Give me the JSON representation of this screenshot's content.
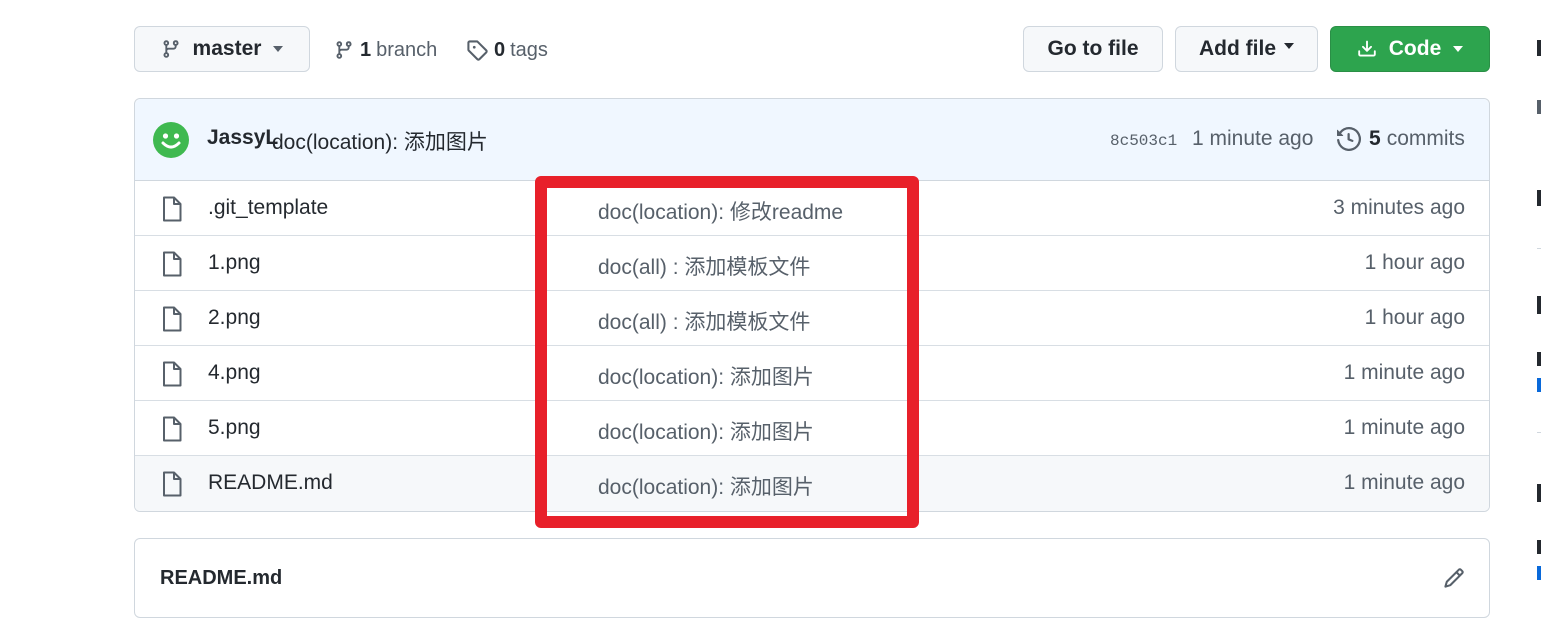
{
  "branch_button": {
    "label": "master"
  },
  "branch_link": {
    "count": "1",
    "label": "branch"
  },
  "tags_link": {
    "count": "0",
    "label": "tags"
  },
  "toolbar": {
    "go_to_file": "Go to file",
    "add_file": "Add file",
    "code": "Code"
  },
  "latest_commit": {
    "author": "JassyL",
    "message": "doc(location): 添加图片",
    "sha": "8c503c1",
    "time": "1 minute ago",
    "commits_count": "5",
    "commits_label": "commits"
  },
  "files": [
    {
      "name": ".git_template",
      "message": "doc(location): 修改readme",
      "time": "3 minutes ago"
    },
    {
      "name": "1.png",
      "message": "doc(all) : 添加模板文件",
      "time": "1 hour ago"
    },
    {
      "name": "2.png",
      "message": "doc(all) : 添加模板文件",
      "time": "1 hour ago"
    },
    {
      "name": "4.png",
      "message": "doc(location): 添加图片",
      "time": "1 minute ago"
    },
    {
      "name": "5.png",
      "message": "doc(location): 添加图片",
      "time": "1 minute ago"
    },
    {
      "name": "README.md",
      "message": "doc(location): 添加图片",
      "time": "1 minute ago"
    }
  ],
  "readme": {
    "title": "README.md"
  },
  "colors": {
    "code_button": "#2da44e",
    "highlight_box": "#e8202a",
    "commit_header": "#f0f7ff",
    "avatar": "#3fb950"
  },
  "icons": [
    "branch-icon",
    "git-branch-icon",
    "tag-icon",
    "download-icon",
    "history-icon",
    "file-icon",
    "pencil-icon"
  ]
}
